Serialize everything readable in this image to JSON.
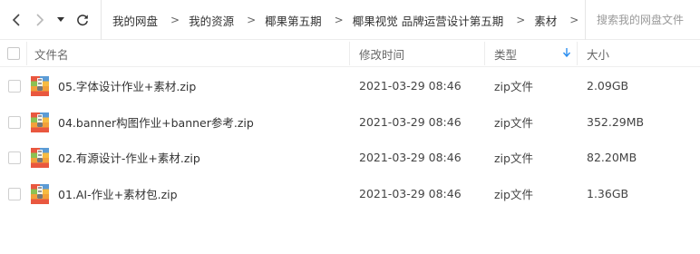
{
  "toolbar": {
    "back_icon": "chevron-left-icon",
    "forward_icon": "chevron-right-icon",
    "history_icon": "caret-down-icon",
    "refresh_icon": "refresh-icon"
  },
  "breadcrumb": {
    "items": [
      "我的网盘",
      "我的资源",
      "椰果第五期",
      "椰果视觉 品牌运营设计第五期",
      "素材"
    ],
    "separator": ">"
  },
  "search": {
    "placeholder": "搜索我的网盘文件"
  },
  "columns": {
    "name": "文件名",
    "modified": "修改时间",
    "type": "类型",
    "size": "大小",
    "sort_icon": "sort-down-arrow-icon",
    "sort_color": "#2b8ef0"
  },
  "files": [
    {
      "name": "05.字体设计作业+素材.zip",
      "modified": "2021-03-29 08:46",
      "type": "zip文件",
      "size": "2.09GB",
      "icon": "zip-archive-icon"
    },
    {
      "name": "04.banner构图作业+banner参考.zip",
      "modified": "2021-03-29 08:46",
      "type": "zip文件",
      "size": "352.29MB",
      "icon": "zip-archive-icon"
    },
    {
      "name": "02.有源设计-作业+素材.zip",
      "modified": "2021-03-29 08:46",
      "type": "zip文件",
      "size": "82.20MB",
      "icon": "zip-archive-icon"
    },
    {
      "name": "01.AI-作业+素材包.zip",
      "modified": "2021-03-29 08:46",
      "type": "zip文件",
      "size": "1.36GB",
      "icon": "zip-archive-icon"
    }
  ]
}
